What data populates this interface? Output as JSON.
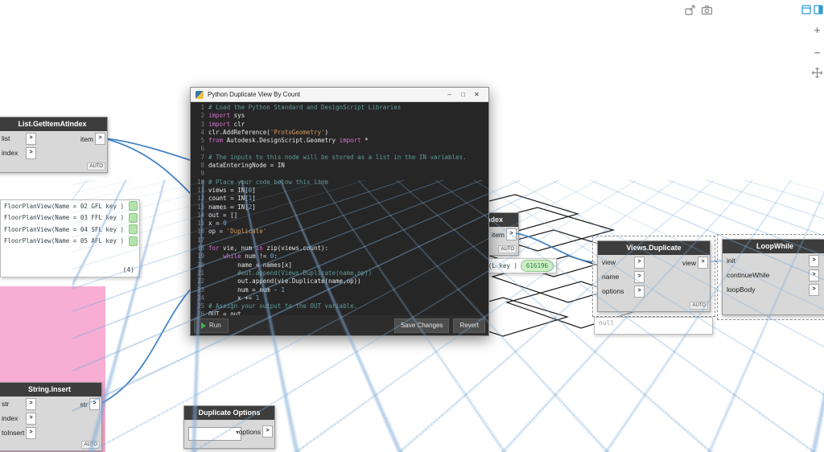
{
  "workspace": {
    "wire_color": "#3d7fc4",
    "grid_color": "#b9d4ea",
    "group_color": "#f8aed4",
    "node_header_color": "#3d3d3d"
  },
  "view_controls": {
    "zoom_in_label": "+",
    "zoom_out_label": "−"
  },
  "python_editor": {
    "title": "Python Duplicate View By Count",
    "controls": {
      "minimize": "–",
      "maximize": "□",
      "close": "✕"
    },
    "footer": {
      "run_label": "Run",
      "save_label": "Save Changes",
      "revert_label": "Revert"
    },
    "code_lines": [
      [
        [
          "c",
          "# Load the Python Standard and DesignScript Libraries"
        ]
      ],
      [
        [
          "k",
          "import"
        ],
        [
          "t",
          " sys"
        ]
      ],
      [
        [
          "k",
          "import"
        ],
        [
          "t",
          " clr"
        ]
      ],
      [
        [
          "t",
          "clr.AddReference("
        ],
        [
          "s",
          "'ProtoGeometry'"
        ],
        [
          "t",
          ")"
        ]
      ],
      [
        [
          "k",
          "from"
        ],
        [
          "t",
          " Autodesk.DesignScript.Geometry "
        ],
        [
          "k",
          "import"
        ],
        [
          "t",
          " *"
        ]
      ],
      [],
      [
        [
          "c",
          "# The inputs to this node will be stored as a list in the IN variables."
        ]
      ],
      [
        [
          "t",
          "dataEnteringNode = IN"
        ]
      ],
      [],
      [
        [
          "c",
          "# Place your code below this line"
        ]
      ],
      [
        [
          "t",
          "views = IN["
        ],
        [
          "n",
          "0"
        ],
        [
          "t",
          "]"
        ]
      ],
      [
        [
          "t",
          "count = IN["
        ],
        [
          "n",
          "1"
        ],
        [
          "t",
          "]"
        ]
      ],
      [
        [
          "t",
          "names = IN["
        ],
        [
          "n",
          "2"
        ],
        [
          "t",
          "]"
        ]
      ],
      [
        [
          "t",
          "out = []"
        ]
      ],
      [
        [
          "t",
          "x = "
        ],
        [
          "n",
          "0"
        ]
      ],
      [
        [
          "t",
          "op = "
        ],
        [
          "s",
          "'Duplicate'"
        ]
      ],
      [],
      [
        [
          "k",
          "for"
        ],
        [
          "t",
          " vie, num "
        ],
        [
          "k",
          "in"
        ],
        [
          "t",
          " zip(views,count):"
        ]
      ],
      [
        [
          "t",
          "    "
        ],
        [
          "k",
          "while"
        ],
        [
          "t",
          " num != "
        ],
        [
          "n",
          "0"
        ],
        [
          "t",
          ":"
        ]
      ],
      [
        [
          "t",
          "        name = names[x]"
        ]
      ],
      [
        [
          "c",
          "        #out.append(Views.Duplicate(name,op))"
        ]
      ],
      [
        [
          "t",
          "        out.append(vie.Duplicate(name,op))"
        ]
      ],
      [
        [
          "t",
          "        num = num - "
        ],
        [
          "n",
          "1"
        ]
      ],
      [
        [
          "t",
          "        x += "
        ],
        [
          "n",
          "1"
        ]
      ],
      [
        [
          "c",
          "# Assign your output to the OUT variable."
        ]
      ],
      [
        [
          "t",
          "OUT = out"
        ]
      ]
    ]
  },
  "nodes": {
    "list_get_item": {
      "title": "List.GetItemAtIndex",
      "inputs": [
        "list",
        "index"
      ],
      "output": "item",
      "badge": "AUTO"
    },
    "hidden_list_node": {
      "title": "List.GetItemAtIndex",
      "output": "item",
      "badge": "AUTO"
    },
    "string_insert": {
      "title": "String.Insert",
      "inputs": [
        "str",
        "index",
        "toInsert"
      ],
      "output": "str",
      "badge": "AUTO"
    },
    "duplicate_options": {
      "title": "Duplicate Options",
      "output": "options"
    },
    "views_duplicate": {
      "title": "Views.Duplicate",
      "inputs": [
        "view",
        "name",
        "options"
      ],
      "output": "view",
      "badge": "AUTO"
    },
    "loop_while": {
      "title": "LoopWhile",
      "inputs": [
        "init",
        "continueWhile",
        "loopBody"
      ]
    }
  },
  "preview_bubble": {
    "items": [
      "FloorPlanView(Name = 02 GFL key )",
      "FloorPlanView(Name = 03 FFL key )",
      "FloorPlanView(Name = 04 SFL key )",
      "FloorPlanView(Name = 05 AFL key )"
    ],
    "count": "(4)"
  },
  "partial_preview": {
    "text": "(L key )",
    "id_badge": "616196"
  },
  "watch_value": {
    "value": "null"
  }
}
